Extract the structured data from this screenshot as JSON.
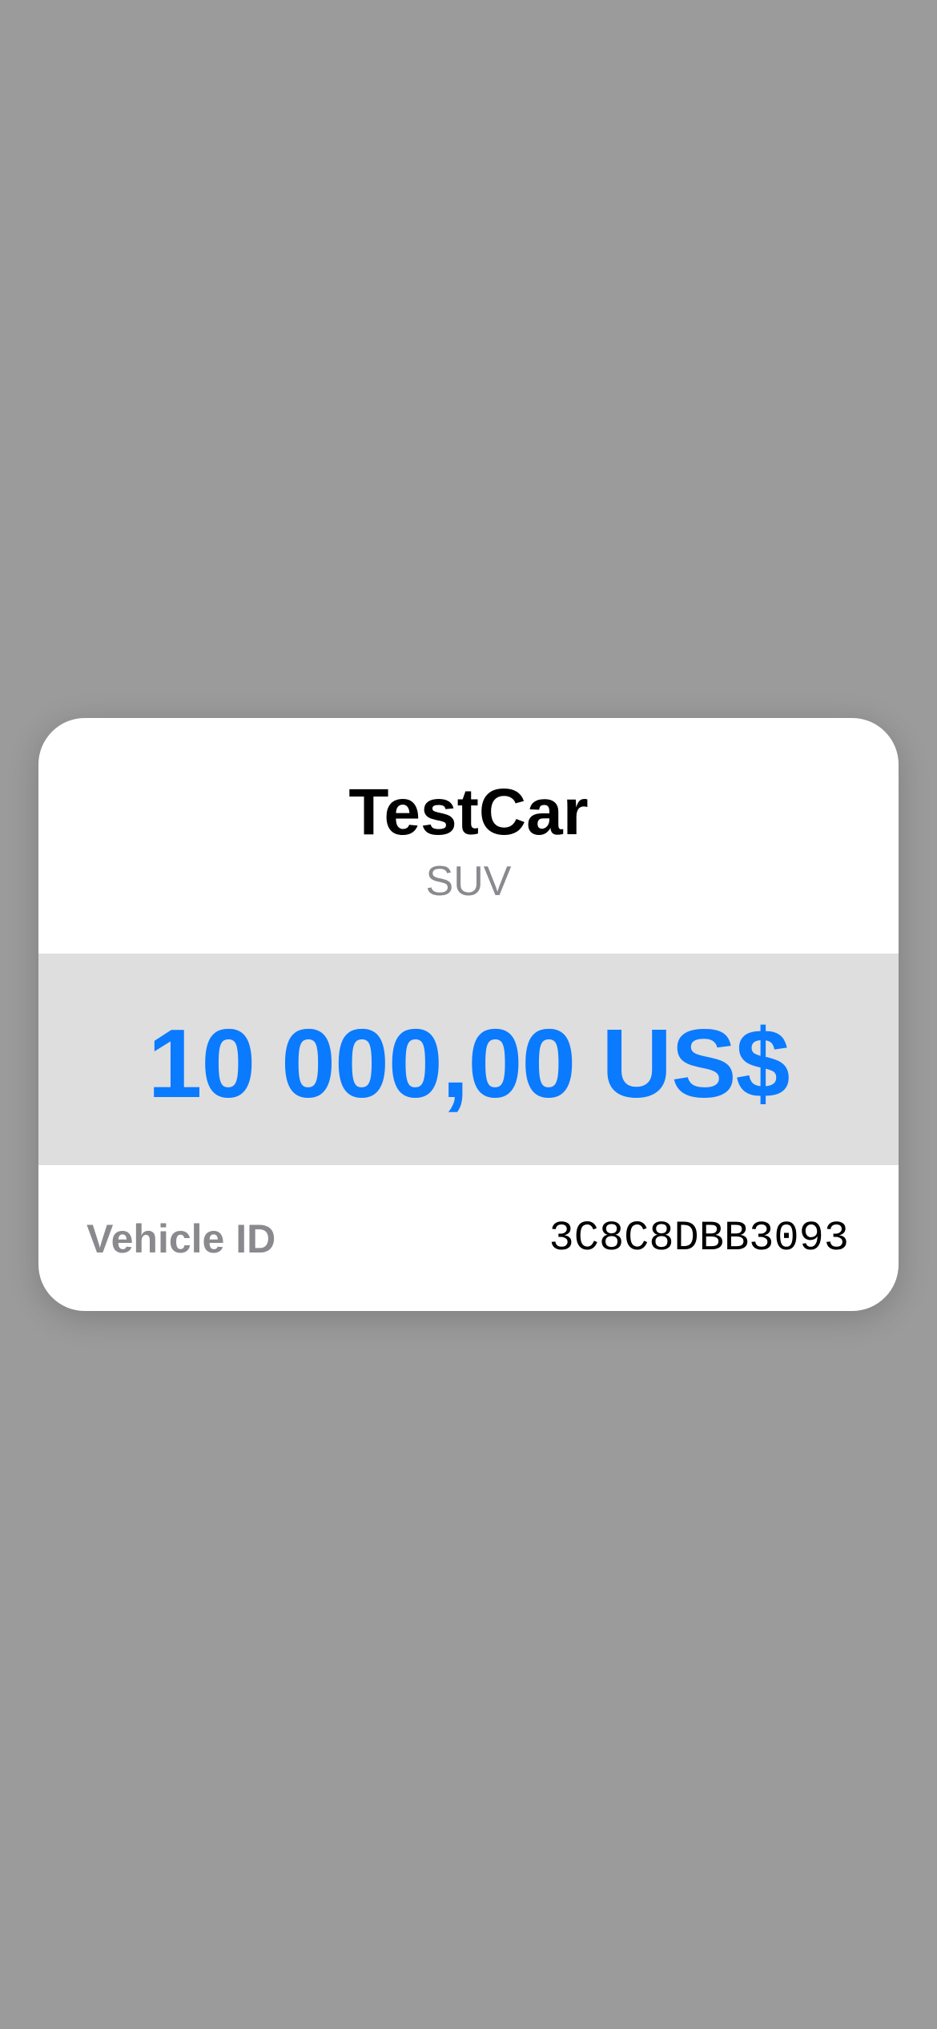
{
  "card": {
    "title": "TestCar",
    "subtitle": "SUV",
    "price": "10 000,00 US$",
    "vehicle_id_label": "Vehicle ID",
    "vehicle_id_value": "3C8C8DBB3093"
  },
  "colors": {
    "backdrop": "#9b9b9b",
    "card_background": "#ffffff",
    "price_band": "#dedede",
    "price_text": "#0a7aff",
    "secondary_text": "#8a8a8e"
  }
}
